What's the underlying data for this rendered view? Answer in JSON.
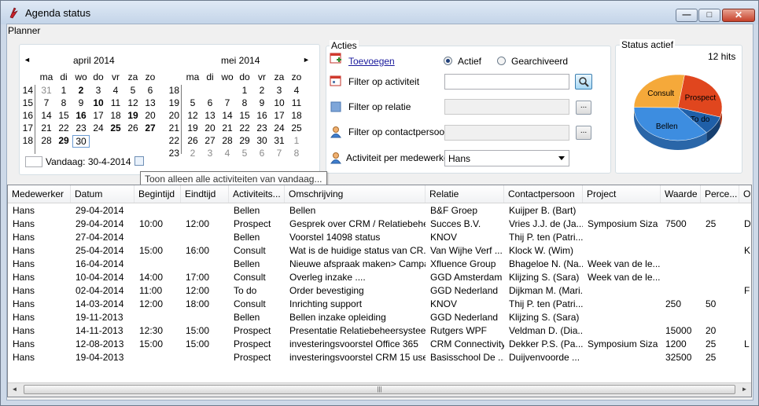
{
  "window": {
    "title": "Agenda status",
    "minimize_glyph": "—",
    "maximize_glyph": "□",
    "close_glyph": "✕"
  },
  "planner": {
    "label": "Planner"
  },
  "calendar": {
    "prev_glyph": "◄",
    "next_glyph": "►",
    "day_headers": [
      "ma",
      "di",
      "wo",
      "do",
      "vr",
      "za",
      "zo"
    ],
    "months": [
      {
        "title": "april 2014",
        "weeks": [
          {
            "wk": "14",
            "days": [
              {
                "d": "31",
                "gray": true
              },
              {
                "d": "1"
              },
              {
                "d": "2",
                "bold": true
              },
              {
                "d": "3"
              },
              {
                "d": "4"
              },
              {
                "d": "5"
              },
              {
                "d": "6"
              }
            ]
          },
          {
            "wk": "15",
            "days": [
              {
                "d": "7"
              },
              {
                "d": "8"
              },
              {
                "d": "9"
              },
              {
                "d": "10",
                "bold": true
              },
              {
                "d": "11"
              },
              {
                "d": "12"
              },
              {
                "d": "13"
              }
            ]
          },
          {
            "wk": "16",
            "days": [
              {
                "d": "14"
              },
              {
                "d": "15"
              },
              {
                "d": "16",
                "bold": true
              },
              {
                "d": "17"
              },
              {
                "d": "18"
              },
              {
                "d": "19",
                "bold": true
              },
              {
                "d": "20"
              }
            ]
          },
          {
            "wk": "17",
            "days": [
              {
                "d": "21"
              },
              {
                "d": "22"
              },
              {
                "d": "23"
              },
              {
                "d": "24"
              },
              {
                "d": "25",
                "bold": true
              },
              {
                "d": "26"
              },
              {
                "d": "27",
                "bold": true
              }
            ]
          },
          {
            "wk": "18",
            "days": [
              {
                "d": "28"
              },
              {
                "d": "29",
                "bold": true
              },
              {
                "d": "30",
                "today": true
              }
            ]
          }
        ]
      },
      {
        "title": "mei 2014",
        "weeks": [
          {
            "wk": "18",
            "days": [
              {
                "d": ""
              },
              {
                "d": ""
              },
              {
                "d": ""
              },
              {
                "d": "1"
              },
              {
                "d": "2"
              },
              {
                "d": "3"
              },
              {
                "d": "4"
              }
            ]
          },
          {
            "wk": "19",
            "days": [
              {
                "d": "5"
              },
              {
                "d": "6"
              },
              {
                "d": "7"
              },
              {
                "d": "8"
              },
              {
                "d": "9"
              },
              {
                "d": "10"
              },
              {
                "d": "11"
              }
            ]
          },
          {
            "wk": "20",
            "days": [
              {
                "d": "12"
              },
              {
                "d": "13"
              },
              {
                "d": "14"
              },
              {
                "d": "15"
              },
              {
                "d": "16"
              },
              {
                "d": "17"
              },
              {
                "d": "18"
              }
            ]
          },
          {
            "wk": "21",
            "days": [
              {
                "d": "19"
              },
              {
                "d": "20"
              },
              {
                "d": "21"
              },
              {
                "d": "22"
              },
              {
                "d": "23"
              },
              {
                "d": "24"
              },
              {
                "d": "25"
              }
            ]
          },
          {
            "wk": "22",
            "days": [
              {
                "d": "26"
              },
              {
                "d": "27"
              },
              {
                "d": "28"
              },
              {
                "d": "29"
              },
              {
                "d": "30"
              },
              {
                "d": "31"
              },
              {
                "d": "1",
                "gray": true
              }
            ]
          },
          {
            "wk": "23",
            "days": [
              {
                "d": "2",
                "gray": true
              },
              {
                "d": "3",
                "gray": true
              },
              {
                "d": "4",
                "gray": true
              },
              {
                "d": "5",
                "gray": true
              },
              {
                "d": "6",
                "gray": true
              },
              {
                "d": "7",
                "gray": true
              },
              {
                "d": "8",
                "gray": true
              }
            ]
          }
        ]
      }
    ],
    "today_label": "Vandaag: 30-4-2014"
  },
  "tooltip": "Toon alleen alle activiteiten van vandaag...",
  "acties": {
    "label": "Acties",
    "add_link": "Toevoegen",
    "radio_active": "Actief",
    "radio_archived": "Gearchiveerd",
    "filter_activity": "Filter op activiteit",
    "filter_relation": "Filter op relatie",
    "filter_contact": "Filter op contactpersoon",
    "activity_per_employee": "Activiteit per medewerker",
    "employee_value": "Hans",
    "dots": "..."
  },
  "status": {
    "label": "Status actief",
    "hits": "12 hits",
    "colors": {
      "prospect": "#e0461e",
      "todo": "#1f5fa8",
      "bellen": "#3d8de0",
      "consult": "#f5a93a"
    }
  },
  "chart_data": {
    "type": "pie",
    "categories": [
      "Prospect",
      "To do",
      "Bellen",
      "Consult"
    ],
    "values": [
      3,
      1,
      4,
      3
    ]
  },
  "grid": {
    "columns": [
      "Medewerker",
      "Datum",
      "Begintijd",
      "Eindtijd",
      "Activiteits...",
      "Omschrijving",
      "Relatie",
      "Contactpersoon",
      "Project",
      "Waarde",
      "Perce...",
      "O"
    ],
    "rows": [
      [
        "Hans",
        "29-04-2014",
        "",
        "",
        "Bellen",
        "Bellen",
        "B&F Groep",
        "Kuijper B. (Bart)",
        "",
        "",
        "",
        ""
      ],
      [
        "Hans",
        "29-04-2014",
        "10:00",
        "12:00",
        "Prospect",
        "Gesprek over CRM / Relatiebehe...",
        "Succes B.V.",
        "Vries J.J. de (Ja...",
        "Symposium Siza ...",
        "7500",
        "25",
        "D"
      ],
      [
        "Hans",
        "27-04-2014",
        "",
        "",
        "Bellen",
        "Voorstel 14098 status",
        "KNOV",
        "Thij P. ten (Patri...",
        "",
        "",
        "",
        ""
      ],
      [
        "Hans",
        "25-04-2014",
        "15:00",
        "16:00",
        "Consult",
        "Wat is de huidige status van CR...",
        "Van Wijhe Verf ...",
        "Klock W. (Wim)",
        "",
        "",
        "",
        "K"
      ],
      [
        "Hans",
        "16-04-2014",
        "",
        "",
        "Bellen",
        "Nieuwe afspraak maken> Campa...",
        "Xfluence Group",
        "Bhageloe N. (Na...",
        "Week van de le...",
        "",
        "",
        ""
      ],
      [
        "Hans",
        "10-04-2014",
        "14:00",
        "17:00",
        "Consult",
        "Overleg inzake ....",
        "GGD Amsterdam",
        "Klijzing S. (Sara)",
        "Week van de le...",
        "",
        "",
        ""
      ],
      [
        "Hans",
        "02-04-2014",
        "11:00",
        "12:00",
        "To do",
        "Order bevestiging",
        "GGD Nederland",
        "Dijkman M. (Mari...",
        "",
        "",
        "",
        "F"
      ],
      [
        "Hans",
        "14-03-2014",
        "12:00",
        "18:00",
        "Consult",
        "Inrichting support",
        "KNOV",
        "Thij P. ten (Patri...",
        "",
        "250",
        "50",
        ""
      ],
      [
        "Hans",
        "19-11-2013",
        "",
        "",
        "Bellen",
        "Bellen inzake opleiding",
        "GGD Nederland",
        "Klijzing S. (Sara)",
        "",
        "",
        "",
        ""
      ],
      [
        "Hans",
        "14-11-2013",
        "12:30",
        "15:00",
        "Prospect",
        "Presentatie Relatiebeheersysteem",
        "Rutgers WPF",
        "Veldman D. (Dia...",
        "",
        "15000",
        "20",
        ""
      ],
      [
        "Hans",
        "12-08-2013",
        "15:00",
        "15:00",
        "Prospect",
        "investeringsvoorstel Office 365",
        "CRM Connectivity",
        "Dekker P.S. (Pa...",
        "Symposium Siza ...",
        "1200",
        "25",
        "L"
      ],
      [
        "Hans",
        "19-04-2013",
        "",
        "",
        "Prospect",
        "investeringsvoorstel CRM 15 users",
        "Basisschool De ...",
        "Duijvenvoorde ...",
        "",
        "32500",
        "25",
        ""
      ]
    ]
  },
  "scrollbar": {
    "left_glyph": "◄",
    "right_glyph": "►",
    "grip": "|||"
  }
}
